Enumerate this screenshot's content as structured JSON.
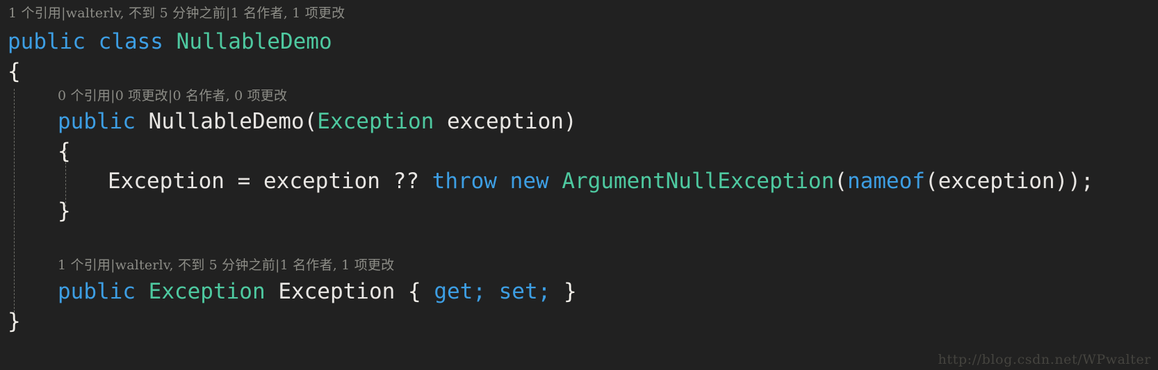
{
  "editor": {
    "background_color": "#212121",
    "default_text_color": "#e8e6e3",
    "keyword_color": "#3d9ee3",
    "type_color": "#4ec9a0",
    "codelens_color": "#8d8d87",
    "indent_guide_color": "#6e6e68"
  },
  "codelens": {
    "class": "1 个引用|walterlv, 不到 5 分钟之前|1 名作者, 1 项更改",
    "constructor": "0 个引用|0 项更改|0 名作者, 0 项更改",
    "property": "1 个引用|walterlv, 不到 5 分钟之前|1 名作者, 1 项更改"
  },
  "code": {
    "class_decl": {
      "kw_public": "public",
      "kw_class": "class",
      "name": "NullableDemo"
    },
    "class_open_brace": "{",
    "ctor_decl": {
      "kw_public": "public",
      "name": "NullableDemo",
      "paren_open": "(",
      "param_type": "Exception",
      "param_name": "exception",
      "paren_close": ")"
    },
    "ctor_open_brace": "{",
    "assignment": {
      "target": "Exception",
      "equals": "=",
      "source": "exception",
      "null_coalesce": "??",
      "kw_throw": "throw",
      "kw_new": "new",
      "exception_type": "ArgumentNullException",
      "paren_open": "(",
      "kw_nameof": "nameof",
      "nameof_open": "(",
      "nameof_arg": "exception",
      "nameof_close": ")",
      "paren_close": ")",
      "semicolon": ";"
    },
    "ctor_close_brace": "}",
    "property_decl": {
      "kw_public": "public",
      "type": "Exception",
      "name": "Exception",
      "brace_open": "{",
      "kw_get": "get;",
      "kw_set": "set;",
      "brace_close": "}"
    },
    "class_close_brace": "}"
  },
  "watermark": {
    "url": "http://blog.csdn.net/WPwalter"
  }
}
